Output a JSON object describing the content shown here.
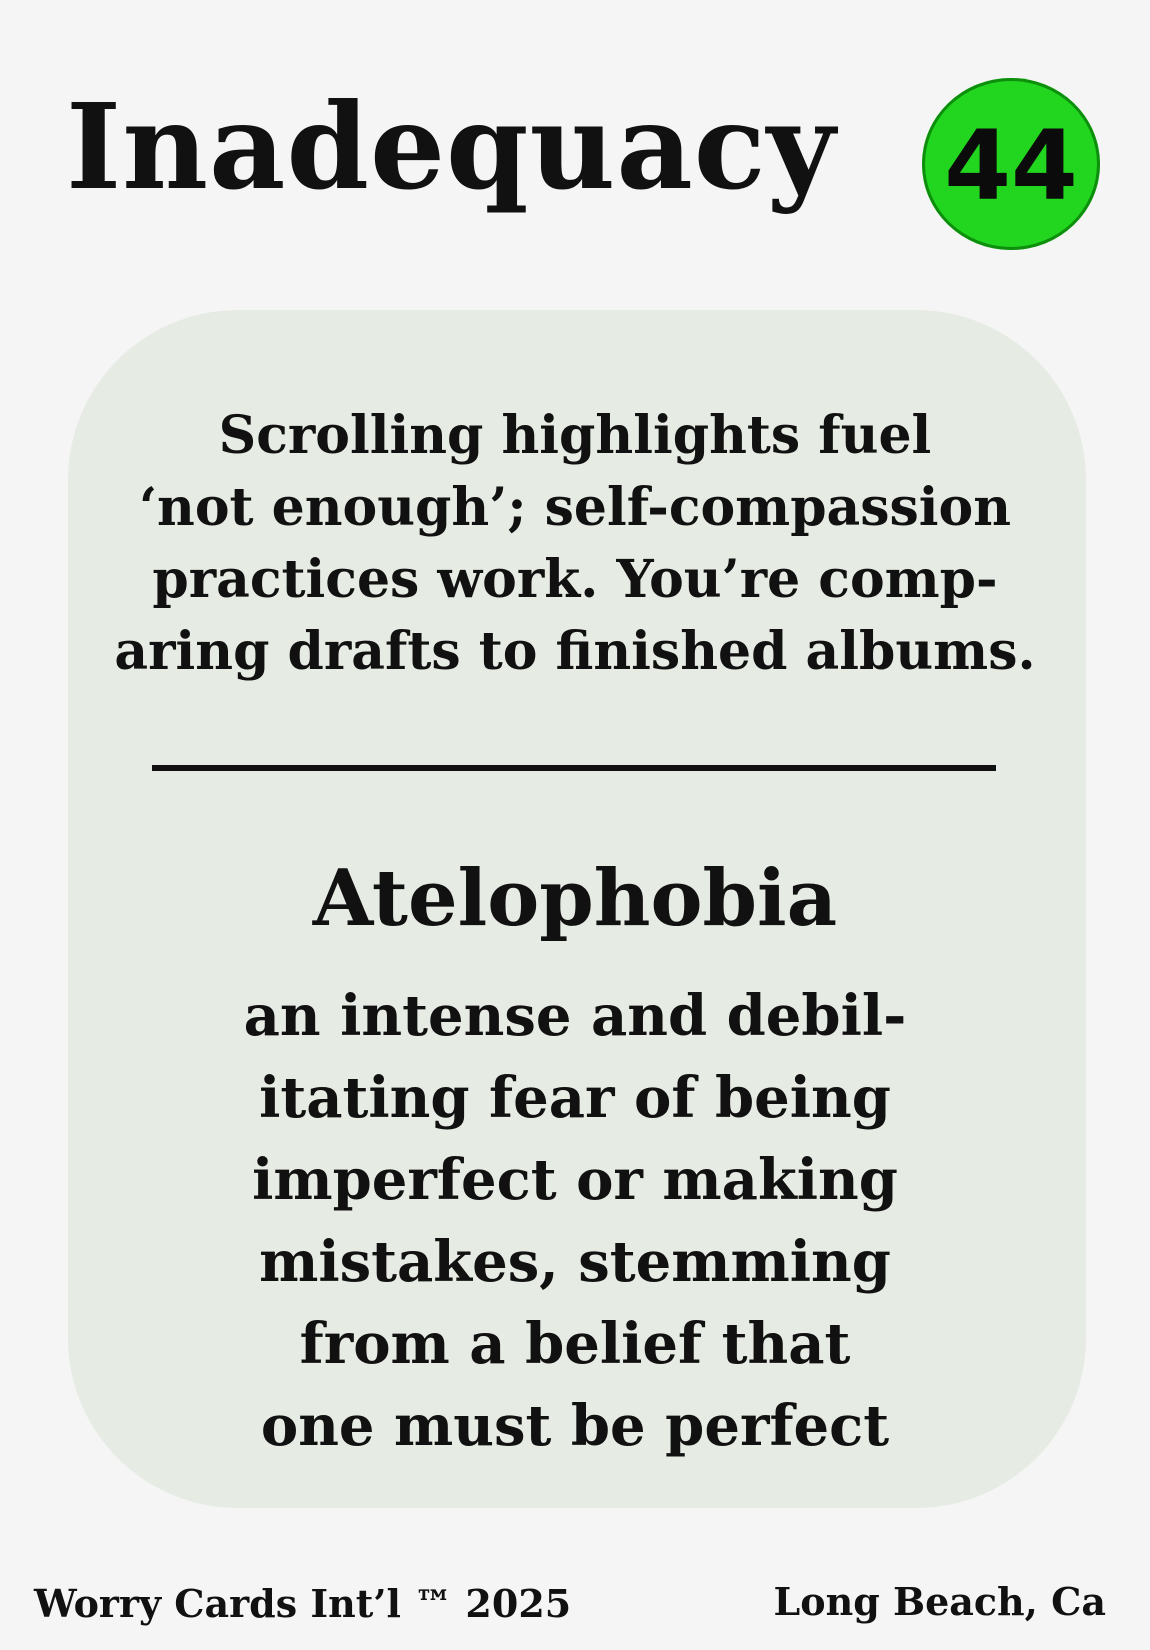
{
  "card": {
    "title": "Inadequacy",
    "number": "44",
    "badge_color": "#22d61f",
    "panel_color": "#e6ebe3",
    "worry_text": "Scrolling highlights fuel\n‘not enough’; self-compassion\npractices work. You’re comp-\naring drafts to finished albums.",
    "term": "Atelophobia",
    "definition": "an intense and debil-\nitating fear of being\nimperfect or making\nmistakes, stemming\nfrom a belief that\none must be perfect"
  },
  "footer": {
    "left": "Worry Cards Int’l ™ 2025",
    "right": "Long Beach, Ca"
  }
}
